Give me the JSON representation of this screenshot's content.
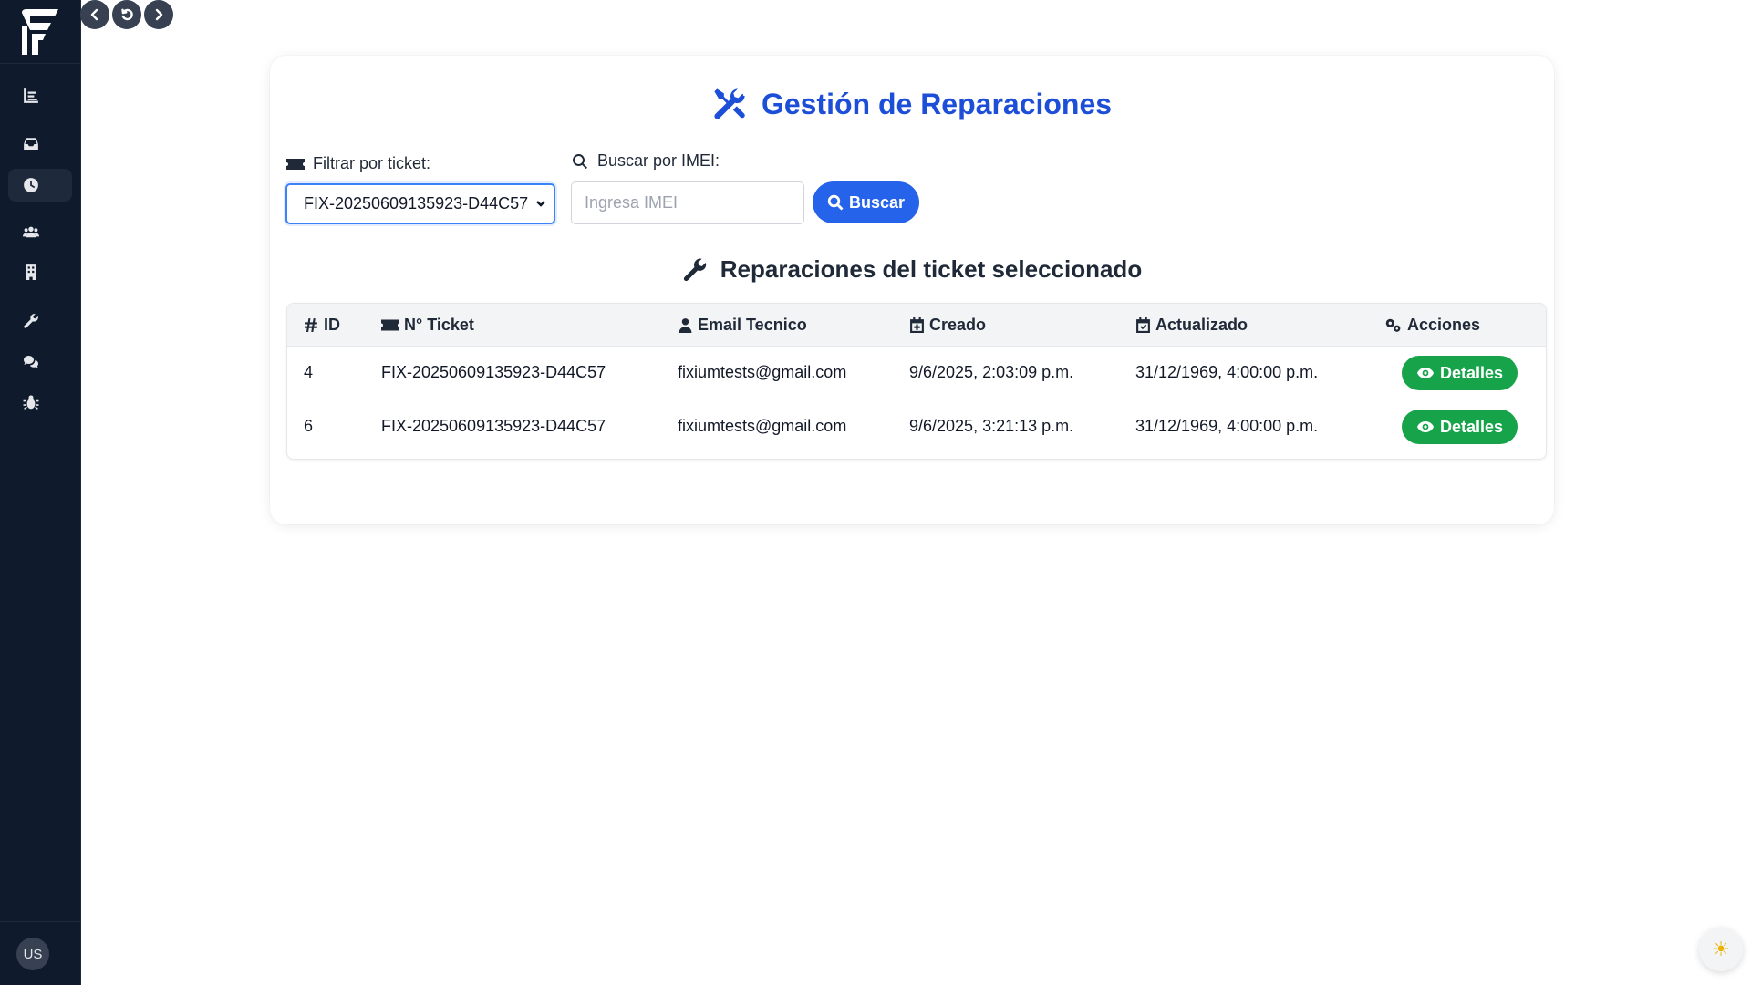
{
  "sidebar": {
    "items": [
      {
        "icon": "chart-icon",
        "active": false
      },
      {
        "icon": "inbox-icon",
        "active": false
      },
      {
        "icon": "clock-icon",
        "active": true
      },
      {
        "icon": "users-icon",
        "active": false
      },
      {
        "icon": "building-icon",
        "active": false
      },
      {
        "icon": "wrench-icon",
        "active": false
      },
      {
        "icon": "comments-icon",
        "active": false
      },
      {
        "icon": "bug-icon",
        "active": false
      }
    ],
    "avatar_initials": "US"
  },
  "topnav": {
    "icons": [
      "chevron-left-icon",
      "reload-icon",
      "chevron-right-icon"
    ]
  },
  "main": {
    "title": "Gestión de Reparaciones",
    "filter_label": "Filtrar por ticket:",
    "filter_selected": "FIX-20250609135923-D44C57",
    "imei_label": "Buscar por IMEI:",
    "imei_placeholder": "Ingresa IMEI",
    "imei_value": "",
    "search_button": "Buscar",
    "section_title": "Reparaciones del ticket seleccionado",
    "table": {
      "headers": [
        "ID",
        "N° Ticket",
        "Email Tecnico",
        "Creado",
        "Actualizado",
        "Acciones"
      ],
      "rows": [
        {
          "id": "4",
          "ticket": "FIX-20250609135923-D44C57",
          "email": "fixiumtests@gmail.com",
          "created": "9/6/2025, 2:03:09 p.m.",
          "updated": "31/12/1969, 4:00:00 p.m.",
          "action": "Detalles"
        },
        {
          "id": "6",
          "ticket": "FIX-20250609135923-D44C57",
          "email": "fixiumtests@gmail.com",
          "created": "9/6/2025, 3:21:13 p.m.",
          "updated": "31/12/1969, 4:00:00 p.m.",
          "action": "Detalles"
        }
      ]
    }
  },
  "theme_toggle_icon": "sun-icon",
  "colors": {
    "sidebar_bg": "#0f1b2d",
    "primary": "#2563eb",
    "title": "#1d4ed8",
    "success": "#16a34a"
  }
}
